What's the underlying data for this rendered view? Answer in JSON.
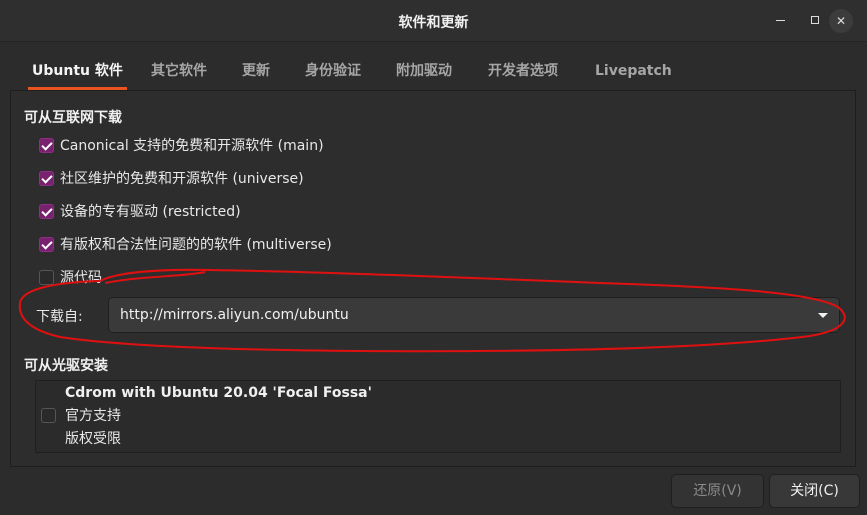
{
  "window": {
    "title": "软件和更新",
    "minimize_glyph": "",
    "close_glyph": "✕"
  },
  "tabs": [
    {
      "label": "Ubuntu 软件",
      "active": true
    },
    {
      "label": "其它软件",
      "active": false
    },
    {
      "label": "更新",
      "active": false
    },
    {
      "label": "身份验证",
      "active": false
    },
    {
      "label": "附加驱动",
      "active": false
    },
    {
      "label": "开发者选项",
      "active": false
    },
    {
      "label": "Livepatch",
      "active": false
    }
  ],
  "internet": {
    "heading": "可从互联网下载",
    "items": [
      {
        "label": "Canonical 支持的免费和开源软件 (main)",
        "checked": true
      },
      {
        "label": "社区维护的免费和开源软件 (universe)",
        "checked": true
      },
      {
        "label": "设备的专有驱动 (restricted)",
        "checked": true
      },
      {
        "label": "有版权和合法性问题的的软件 (multiverse)",
        "checked": true
      },
      {
        "label": "源代码",
        "checked": false
      }
    ],
    "download_from_label": "下载自:",
    "download_from_value": "http://mirrors.aliyun.com/ubuntu"
  },
  "cdrom": {
    "heading": "可从光驱安装",
    "title": "Cdrom with Ubuntu 20.04 'Focal Fossa'",
    "line1": "官方支持",
    "line2": "版权受限",
    "checked": false
  },
  "buttons": {
    "revert": "还原(V)",
    "close": "关闭(C)"
  },
  "colors": {
    "accent": "#e95420",
    "checkbox": "#77216f",
    "annotation": "#e01010"
  }
}
